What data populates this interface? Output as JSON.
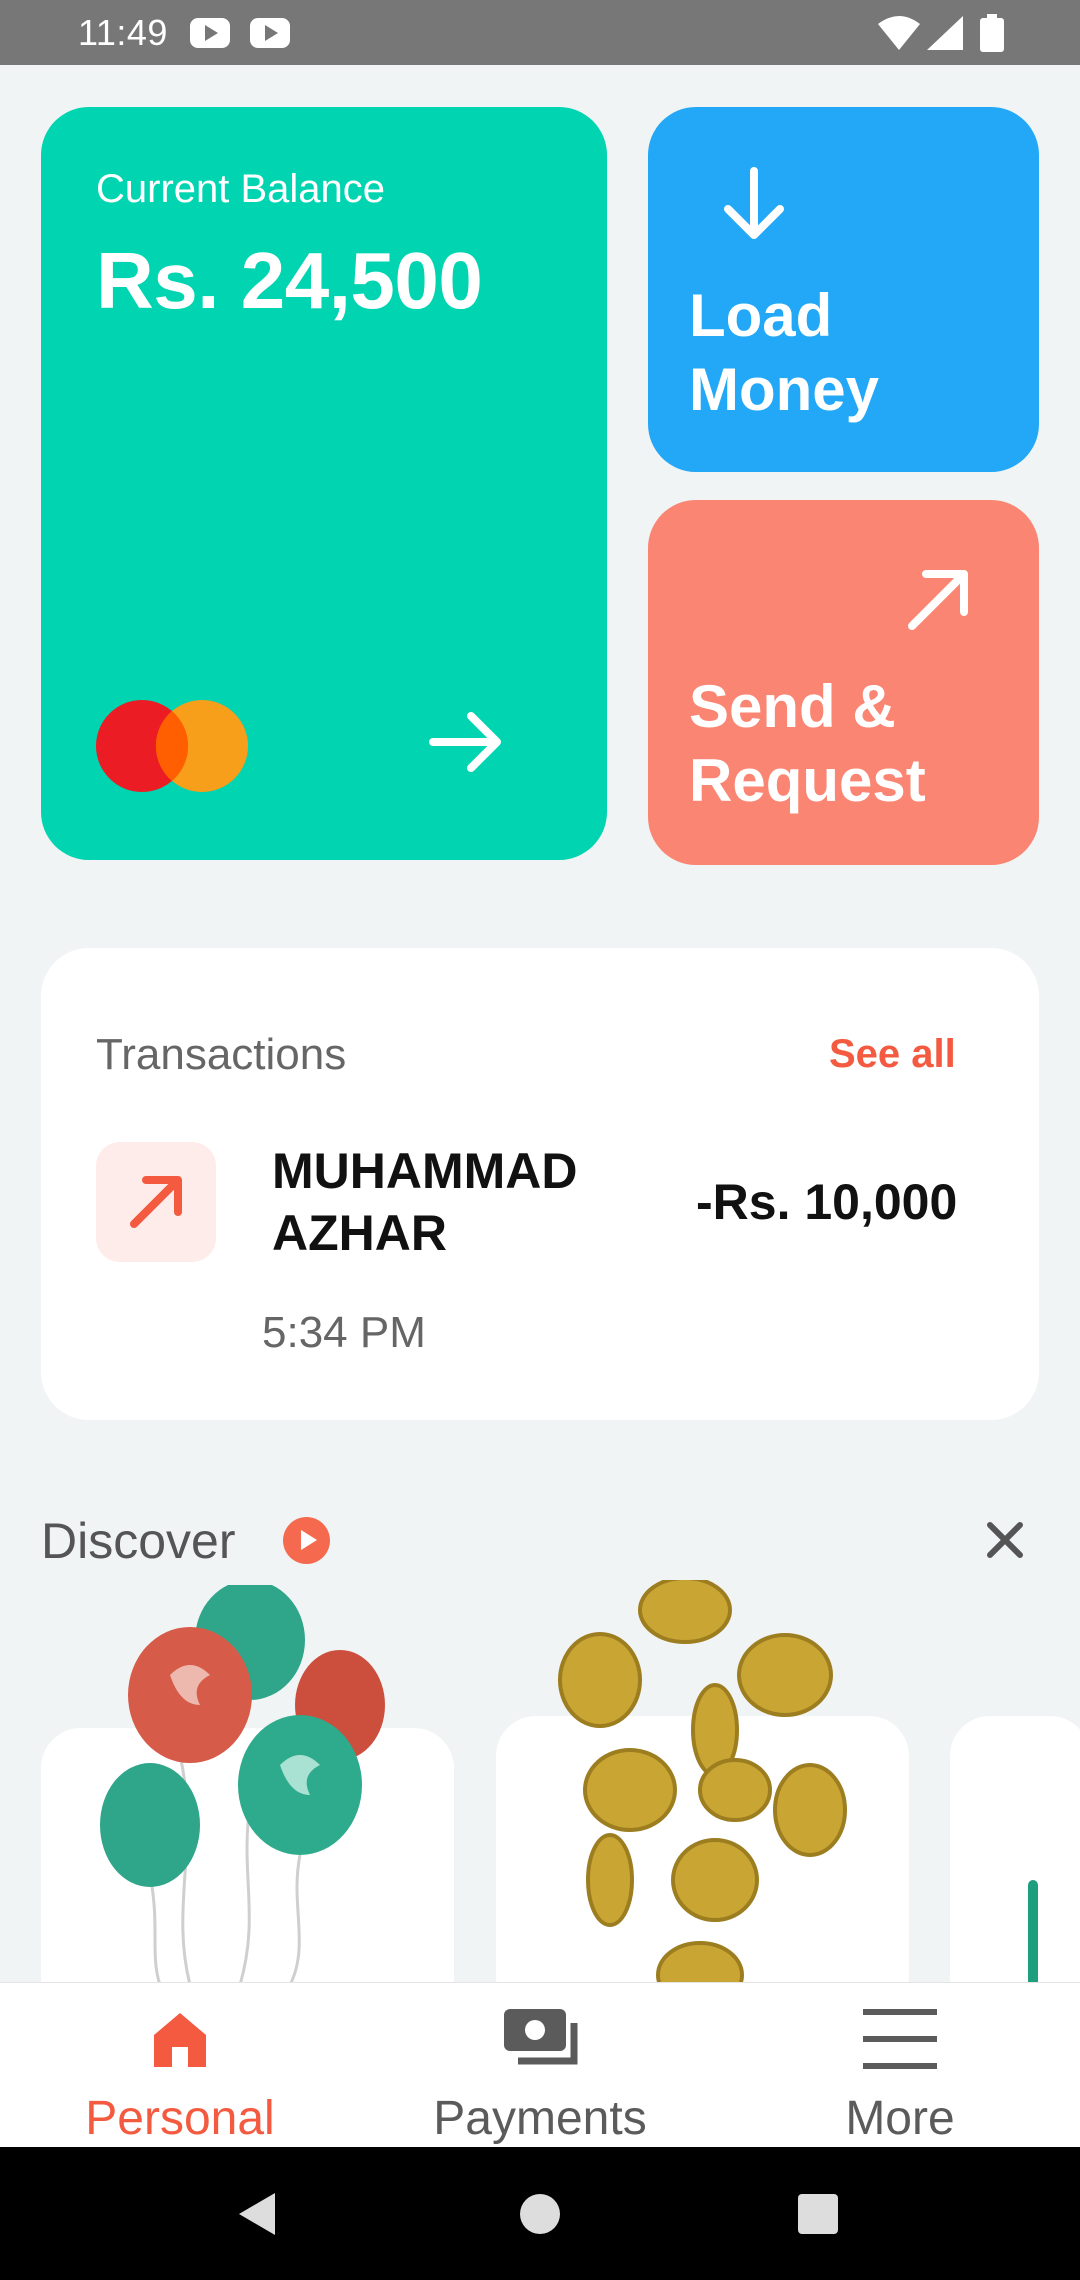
{
  "status": {
    "time": "11:49"
  },
  "balance": {
    "label": "Current Balance",
    "amount": "Rs. 24,500"
  },
  "actions": {
    "load_line1": "Load",
    "load_line2": "Money",
    "send_line1": "Send &",
    "send_line2": "Request"
  },
  "transactions": {
    "title": "Transactions",
    "see_all": "See all",
    "items": [
      {
        "name_line1": "MUHAMMAD",
        "name_line2": "AZHAR",
        "amount": "-Rs. 10,000",
        "time": "5:34 PM",
        "icon": "arrow-up-right-icon"
      }
    ]
  },
  "discover": {
    "title": "Discover"
  },
  "nav": {
    "items": [
      {
        "label": "Personal",
        "icon": "home-icon"
      },
      {
        "label": "Payments",
        "icon": "cash-icon"
      },
      {
        "label": "More",
        "icon": "menu-icon"
      }
    ],
    "active_color": "#f45a3f",
    "inactive_color": "#5b5b5b"
  },
  "colors": {
    "balance_card": "#00d4b1",
    "load_card": "#22a8f6",
    "send_card": "#fa8572",
    "accent": "#f45a3f"
  }
}
